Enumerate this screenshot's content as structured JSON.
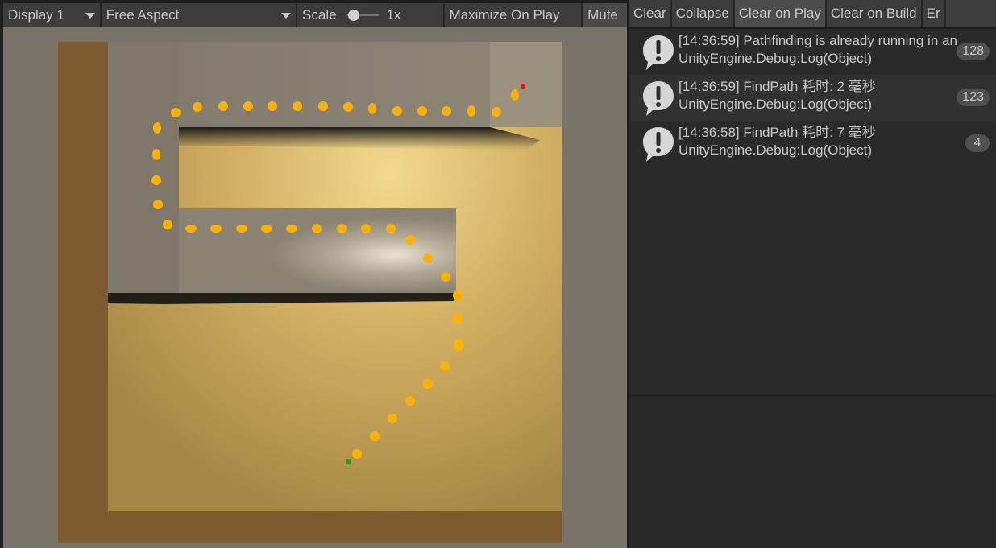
{
  "game_toolbar": {
    "display": "Display 1",
    "aspect": "Free Aspect",
    "scale_label": "Scale",
    "scale_value": "1x",
    "maximize": "Maximize On Play",
    "mute": "Mute"
  },
  "console_toolbar": {
    "clear": "Clear",
    "collapse": "Collapse",
    "clear_on_play": "Clear on Play",
    "clear_on_build": "Clear on Build",
    "error_pause": "Er"
  },
  "logs": [
    {
      "line1": "[14:36:59] Pathfinding is already running in an",
      "line2": "UnityEngine.Debug:Log(Object)",
      "count": "128"
    },
    {
      "line1": "[14:36:59] FindPath 耗时: 2 毫秒",
      "line2": "UnityEngine.Debug:Log(Object)",
      "count": "123"
    },
    {
      "line1": "[14:36:58] FindPath 耗时: 7 毫秒",
      "line2": "UnityEngine.Debug:Log(Object)",
      "count": "4"
    }
  ],
  "colors": {
    "path_dot": "#ffb000",
    "start_marker": "#1aa01a",
    "target_marker": "#d02020",
    "floor": "#c9a55a",
    "wall": "#8a8070"
  }
}
